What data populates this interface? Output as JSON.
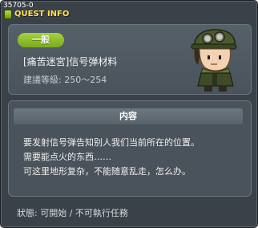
{
  "window": {
    "quest_id": "35705-0",
    "title": "QUEST INFO"
  },
  "quest": {
    "category_badge": "一般",
    "name": "[痛苦迷宮]信号弹材料",
    "level_requirement": "建議等級: 250〜254"
  },
  "content": {
    "header": "内容",
    "lines": [
      "要发射信号弹告知别人我们当前所在的位置。",
      "需要能点火的东西……",
      "可这里地形复杂，不能随意乱走，怎么办。"
    ]
  },
  "status": {
    "text": "狀態: 可開始 / 不可執行任務"
  },
  "colors": {
    "window_bg": "#3a4148",
    "panel_bg": "#4a535b",
    "title_yellow": "#ffe14a",
    "badge_green": "#8bbf2a"
  },
  "icons": {
    "title_icon": "quest-icon",
    "npc": "npc-portrait-soldier-with-goggles"
  }
}
